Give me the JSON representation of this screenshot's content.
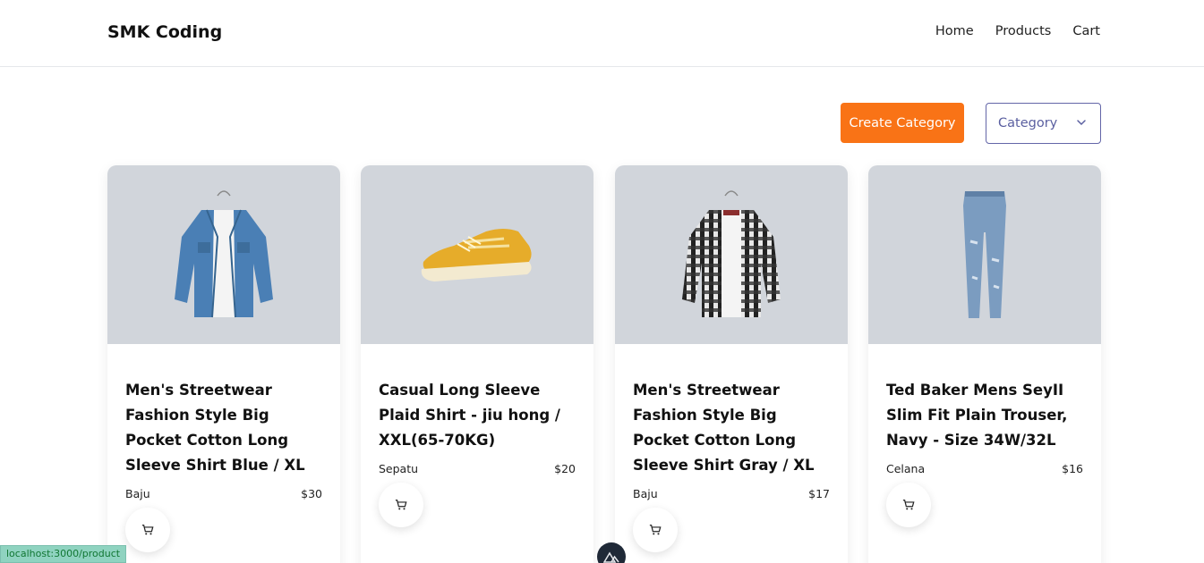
{
  "navbar": {
    "brand": "SMK Coding",
    "links": [
      "Home",
      "Products",
      "Cart"
    ]
  },
  "toolbar": {
    "create_label": "Create Category",
    "category_label": "Category"
  },
  "products": [
    {
      "title": "Men's Streetwear Fashion Style Big Pocket Cotton Long Sleeve Shirt Blue / XL",
      "category": "Baju",
      "price": "$30",
      "image": "denim-shirt-image"
    },
    {
      "title": "Casual Long Sleeve Plaid Shirt - jiu hong / XXL(65-70KG)",
      "category": "Sepatu",
      "price": "$20",
      "image": "sneaker-image"
    },
    {
      "title": "Men's Streetwear Fashion Style Big Pocket Cotton Long Sleeve Shirt Gray / XL",
      "category": "Baju",
      "price": "$17",
      "image": "plaid-shirt-image"
    },
    {
      "title": "Ted Baker Mens SeyII Slim Fit Plain Trouser, Navy - Size 34W/32L",
      "category": "Celana",
      "price": "$16",
      "image": "jeans-image"
    }
  ],
  "status_bar": {
    "url": "localhost:3000/product"
  },
  "colors": {
    "accent": "#f97316",
    "category_border": "#6366a8",
    "image_bg": "#d1d5db"
  }
}
